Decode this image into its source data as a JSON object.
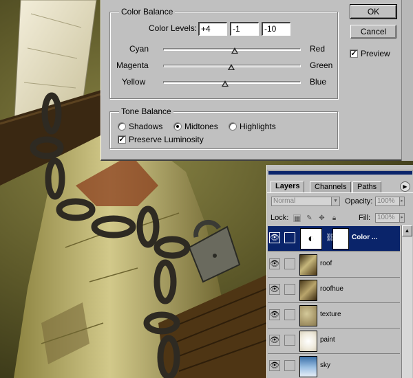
{
  "dialog": {
    "color_balance_title": "Color Balance",
    "color_levels_label": "Color Levels:",
    "levels": [
      "+4",
      "-1",
      "-10"
    ],
    "sliders": [
      {
        "left": "Cyan",
        "right": "Red",
        "value": 4
      },
      {
        "left": "Magenta",
        "right": "Green",
        "value": -1
      },
      {
        "left": "Yellow",
        "right": "Blue",
        "value": -10
      }
    ],
    "tone_balance_title": "Tone Balance",
    "tone_options": [
      "Shadows",
      "Midtones",
      "Highlights"
    ],
    "tone_selected": "Midtones",
    "preserve_luminosity": "Preserve Luminosity",
    "preserve_checked": true,
    "ok": "OK",
    "cancel": "Cancel",
    "preview": "Preview",
    "preview_checked": true
  },
  "layers_panel": {
    "tabs": [
      "Layers",
      "Channels",
      "Paths"
    ],
    "active_tab": "Layers",
    "blend_mode": "Normal",
    "opacity_label": "Opacity:",
    "opacity_value": "100%",
    "lock_label": "Lock:",
    "fill_label": "Fill:",
    "fill_value": "100%",
    "layers": [
      {
        "name": "Color ...",
        "selected": true
      },
      {
        "name": "roof",
        "selected": false
      },
      {
        "name": "roofhue",
        "selected": false
      },
      {
        "name": "texture",
        "selected": false
      },
      {
        "name": "paint",
        "selected": false
      },
      {
        "name": "sky",
        "selected": false
      }
    ]
  },
  "colors": {
    "dialog_bg": "#c0c0c0",
    "selection": "#0a246a"
  }
}
